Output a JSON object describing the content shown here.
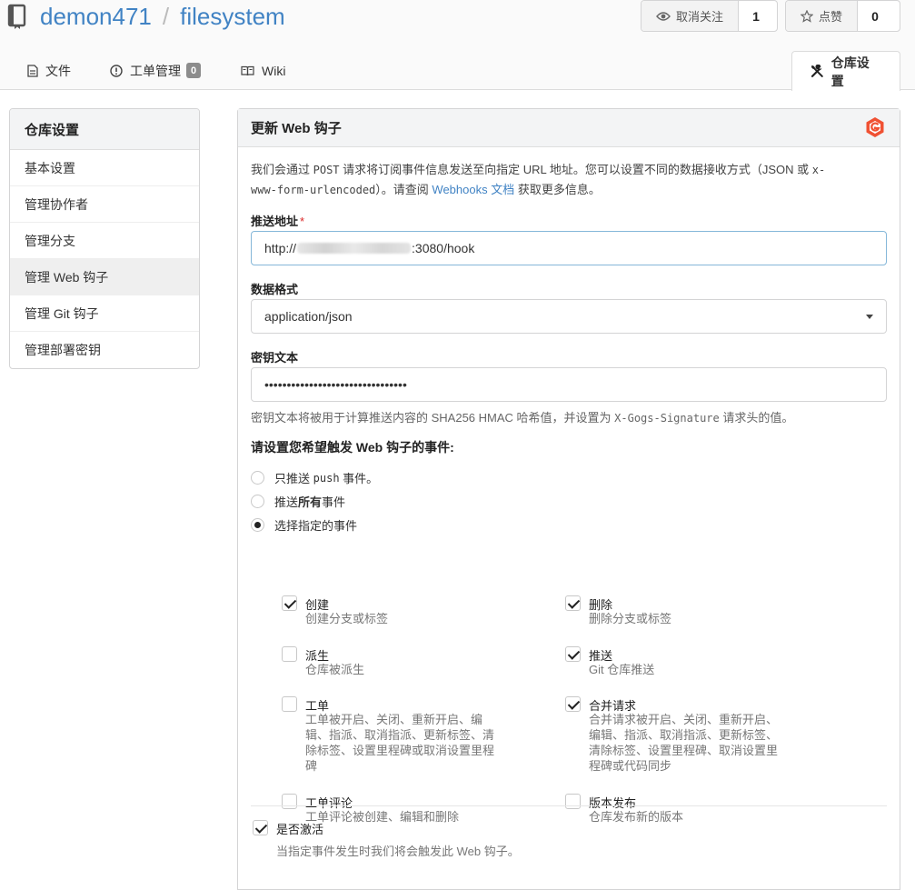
{
  "repo": {
    "owner": "demon471",
    "separator": "/",
    "name": "filesystem"
  },
  "watch": {
    "label": "取消关注",
    "count": "1"
  },
  "star": {
    "label": "点赞",
    "count": "0"
  },
  "tabs": [
    {
      "label": "文件"
    },
    {
      "label": "工单管理",
      "badge": "0"
    },
    {
      "label": "Wiki"
    },
    {
      "label": "仓库设置"
    }
  ],
  "sidebar": {
    "title": "仓库设置",
    "items": [
      {
        "label": "基本设置"
      },
      {
        "label": "管理协作者"
      },
      {
        "label": "管理分支"
      },
      {
        "label": "管理 Web 钩子"
      },
      {
        "label": "管理 Git 钩子"
      },
      {
        "label": "管理部署密钥"
      }
    ]
  },
  "panel": {
    "title": "更新 Web 钩子",
    "desc_part1": "我们会通过 ",
    "desc_post": "POST",
    "desc_part2": " 请求将订阅事件信息发送至向指定 URL 地址。您可以设置不同的数据接收方式（JSON 或 ",
    "desc_mono1": "x-",
    "desc_mono2": "www-form-urlencoded",
    "desc_part3": "）。请查阅 ",
    "desc_link": "Webhooks 文档",
    "desc_part4": " 获取更多信息。"
  },
  "form": {
    "url_label": "推送地址",
    "url_required": "*",
    "url_prefix": "http://",
    "url_suffix": ":3080/hook",
    "format_label": "数据格式",
    "format_value": "application/json",
    "secret_label": "密钥文本",
    "secret_value": "••••••••••••••••••••••••••••••••",
    "secret_help_1": "密钥文本将被用于计算推送内容的 SHA256 HMAC 哈希值，并设置为 ",
    "secret_help_mono": "X-Gogs-Signature",
    "secret_help_2": " 请求头的值。",
    "events_label": "请设置您希望触发 Web 钩子的事件:",
    "radio_push_1": "只推送 ",
    "radio_push_mono": "push",
    "radio_push_2": " 事件。",
    "radio_all_1": "推送 ",
    "radio_all_bold": "所有",
    "radio_all_2": " 事件",
    "radio_choose": "选择指定的事件",
    "active_label": "是否激活",
    "active_help": "当指定事件发生时我们将会触发此 Web 钩子。"
  },
  "events": [
    {
      "title": "创建",
      "desc": "创建分支或标签",
      "checked": true
    },
    {
      "title": "删除",
      "desc": "删除分支或标签",
      "checked": true
    },
    {
      "title": "派生",
      "desc": "仓库被派生",
      "checked": false
    },
    {
      "title": "推送",
      "desc": "Git 仓库推送",
      "checked": true
    },
    {
      "title": "工单",
      "desc": "工单被开启、关闭、重新开启、编辑、指派、取消指派、更新标签、清除标签、设置里程碑或取消设置里程碑",
      "checked": false
    },
    {
      "title": "合并请求",
      "desc": "合并请求被开启、关闭、重新开启、编辑、指派、取消指派、更新标签、清除标签、设置里程碑、取消设置里程碑或代码同步",
      "checked": true
    },
    {
      "title": "工单评论",
      "desc": "工单评论被创建、编辑和删除",
      "checked": false
    },
    {
      "title": "版本发布",
      "desc": "仓库发布新的版本",
      "checked": false
    }
  ],
  "colors": {
    "link": "#4183c4",
    "gogs_brand": "#f05133",
    "badge": "#8c8c8c"
  }
}
